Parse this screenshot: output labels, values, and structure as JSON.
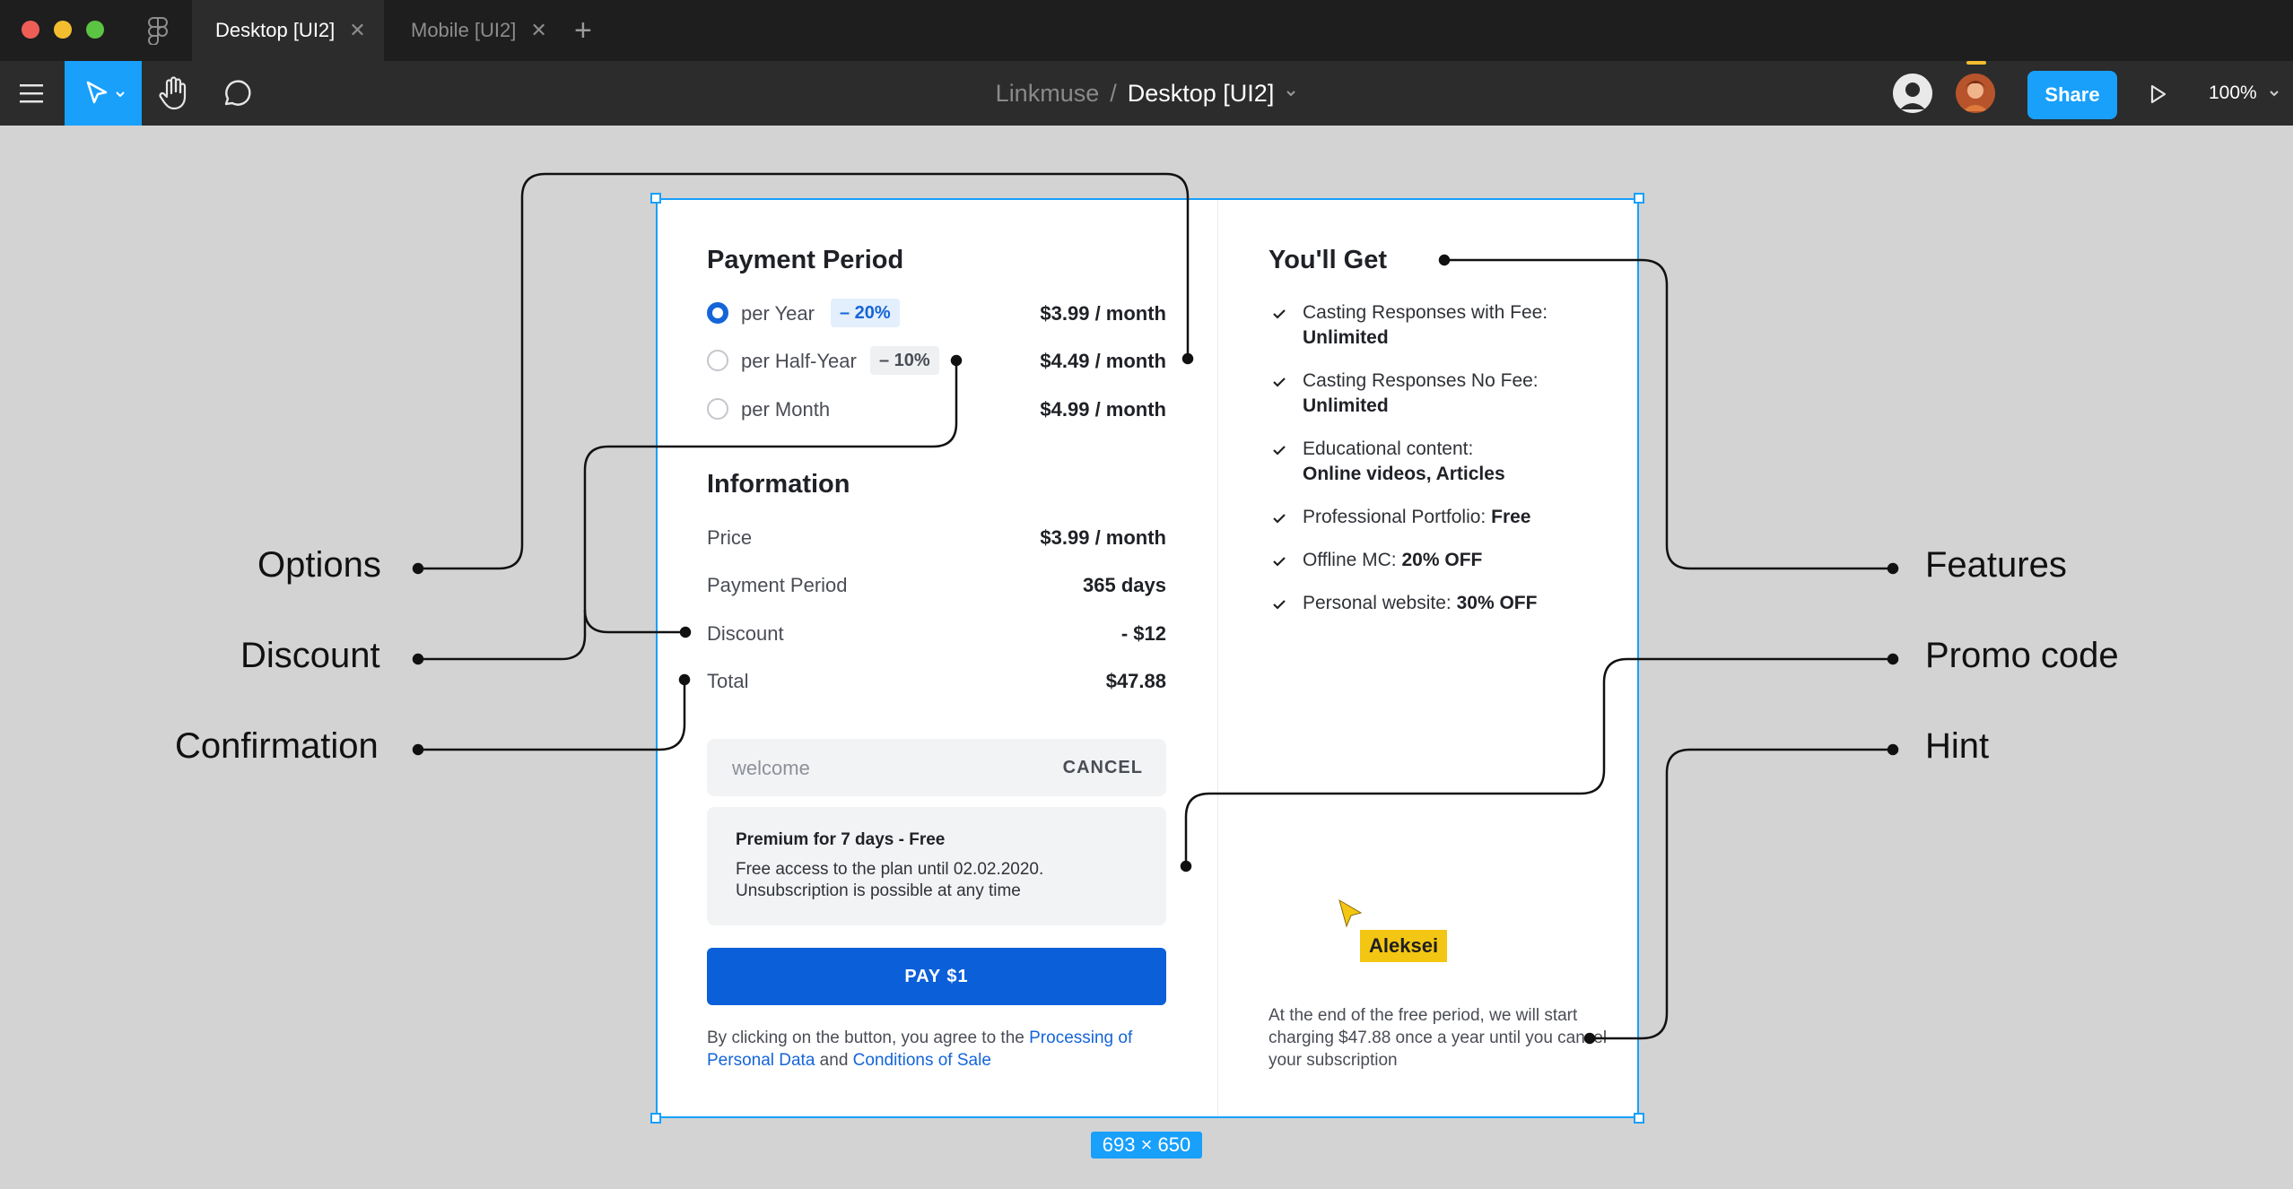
{
  "tabs": [
    {
      "label": "Desktop [UI2]",
      "active": true
    },
    {
      "label": "Mobile [UI2]",
      "active": false
    }
  ],
  "tab_close_glyph": "✕",
  "new_tab_glyph": "+",
  "toolbar": {
    "project": "Linkmuse",
    "separator": "/",
    "file": "Desktop [UI2]",
    "share_label": "Share",
    "zoom": "100%"
  },
  "frame_size_label": "693 × 650",
  "payment": {
    "title": "Payment Period",
    "options": [
      {
        "label": "per Year",
        "discount": "– 20%",
        "price": "$3.99 / month",
        "selected": true
      },
      {
        "label": "per Half-Year",
        "discount": "– 10%",
        "price": "$4.49 / month",
        "selected": false
      },
      {
        "label": "per Month",
        "discount": "",
        "price": "$4.99 / month",
        "selected": false
      }
    ]
  },
  "information": {
    "title": "Information",
    "rows": [
      {
        "label": "Price",
        "value": "$3.99 / month"
      },
      {
        "label": "Payment Period",
        "value": "365 days"
      },
      {
        "label": "Discount",
        "value": "- $12"
      },
      {
        "label": "Total",
        "value": "$47.88"
      }
    ]
  },
  "promo": {
    "value": "welcome",
    "cancel_label": "CANCEL"
  },
  "trial": {
    "title": "Premium for 7 days - Free",
    "line1": "Free access to the plan until 02.02.2020.",
    "line2": "Unsubscription is possible at any time"
  },
  "pay_label": "PAY $1",
  "legal": {
    "prefix": "By clicking on the button, you agree to the ",
    "link1": "Processing of Personal Data",
    "middle": " and ",
    "link2": "Conditions of Sale"
  },
  "features": {
    "title": "You'll Get",
    "items": [
      {
        "label": "Casting Responses with Fee:",
        "value": "Unlimited"
      },
      {
        "label": "Casting Responses No Fee:",
        "value": "Unlimited"
      },
      {
        "label": "Educational content:",
        "value": "Online videos, Articles"
      },
      {
        "label": "Professional Portfolio:",
        "value": "Free"
      },
      {
        "label": "Offline MC:",
        "value": "20% OFF"
      },
      {
        "label": "Personal website:",
        "value": "30% OFF"
      }
    ]
  },
  "hint": "At the end of the free period, we will start charging $47.88 once a year until you cancel your subscription",
  "cursor_user": "Aleksei",
  "annotations": {
    "left": [
      "Options",
      "Discount",
      "Confirmation"
    ],
    "right": [
      "Features",
      "Promo code",
      "Hint"
    ]
  },
  "colors": {
    "figma_blue": "#18a0fb",
    "pay_blue": "#0b5fd9",
    "link_blue": "#1565d8",
    "canvas": "#d3d3d3",
    "cursor_yellow": "#f3c614"
  },
  "icons": [
    "figma-logo-icon",
    "hamburger-icon",
    "move-cursor-icon",
    "hand-icon",
    "comment-icon",
    "chevron-down-icon",
    "play-icon",
    "check-icon"
  ]
}
